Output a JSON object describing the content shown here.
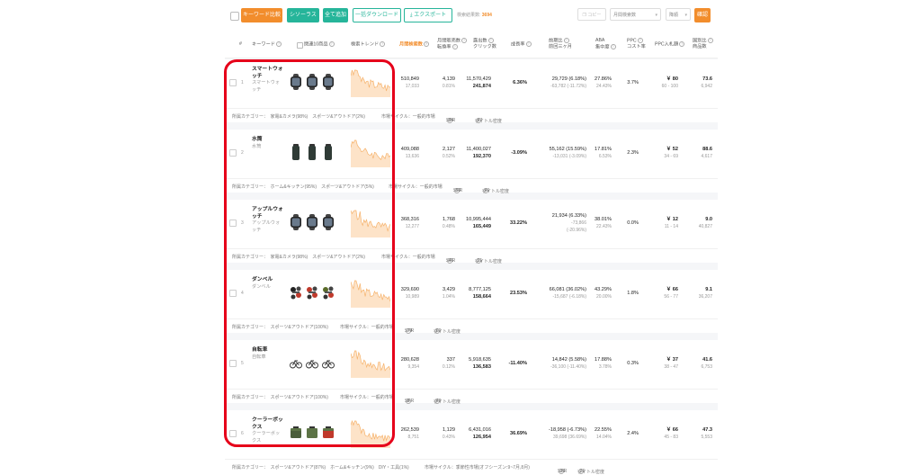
{
  "colors": {
    "accent": "#f28d2c",
    "green": "#26b59a",
    "annotation": "#e6001a"
  },
  "toolbar": {
    "compare_keywords": "キーワード比較",
    "thesaurus": "シソーラス",
    "add_all": "全て追加",
    "bulk_download": "一括ダウンロード",
    "export": "エクスポート",
    "search_results_label": "検索結果数:",
    "search_results_count": "3694",
    "copy": "コピー",
    "sort_select": "月間検索数",
    "order_select": "降順",
    "confirm": "確認"
  },
  "header": {
    "index": "#",
    "keyword": "キーワード",
    "related_products": "関連10商品",
    "search_trend": "検索トレンド",
    "monthly_search": "月間検索数",
    "monthly_sales_1": "月間販売数",
    "monthly_sales_2": "転換率",
    "display_1": "露出数",
    "display_2": "クリック数",
    "growth": "成長率",
    "prev_month_1": "前期比",
    "prev_month_2": "前回三ヶ月",
    "aba_1": "ABA",
    "aba_2": "集中度",
    "ppc_1": "PPC",
    "ppc_2": "コスト率",
    "ppc_bid": "PPC入札額",
    "products_1": "国別比",
    "products_2": "商品数"
  },
  "rows": [
    {
      "index": "1",
      "keyword_lines": [
        "スマートウォ",
        "ッチ"
      ],
      "translation_lines": [
        "スマートウォ",
        "ッチ"
      ],
      "thumb": "watch",
      "search_volume": "510,849",
      "search_sub": "17,033",
      "sales": "4,139",
      "sales_rate": "0.81%",
      "impressions": "11,570,429",
      "clicks": "241,874",
      "growth": "6.36%",
      "prev_main": "29,729 (6.18%)",
      "prev_sub1": "-63,782 (-11.72%)",
      "prev_sub2": "",
      "aba": "27.86%",
      "aba_sub": "24.43%",
      "ppc": "3.7%",
      "bid": "￥ 80",
      "bid_range": "60 - 100",
      "ratio": "73.6",
      "ratio_sub": "6,942",
      "foot": {
        "category": "所属カテゴリー：　家電&カメラ(98%)　スポーツ&アウトドア(2%)",
        "cycle": "市場サイクル：一般的市場",
        "spr": "SPR",
        "spr_val": ": 94",
        "title": "タイトル密度",
        "title_val": ": 47"
      }
    },
    {
      "index": "2",
      "keyword_lines": [
        "水筒"
      ],
      "translation_lines": [
        "水筒"
      ],
      "thumb": "bottle",
      "search_volume": "409,088",
      "search_sub": "13,636",
      "sales": "2,127",
      "sales_rate": "0.52%",
      "impressions": "11,400,027",
      "clicks": "192,370",
      "growth": "-3.09%",
      "prev_main": "55,162 (15.59%)",
      "prev_sub1": "-13,031 (-3.09%)",
      "prev_sub2": "",
      "aba": "17.81%",
      "aba_sub": "6.53%",
      "ppc": "2.3%",
      "bid": "￥ 52",
      "bid_range": "34 - 69",
      "ratio": "88.6",
      "ratio_sub": "4,617",
      "foot": {
        "category": "所属カテゴリー：　ホーム&キッチン(95%)　スポーツ&アウトドア(5%)",
        "cycle": "市場サイクル：一般的市場",
        "spr": "SPR",
        "spr_val": ": 50",
        "title": "タイトル密度",
        "title_val": ": 46"
      }
    },
    {
      "index": "3",
      "keyword_lines": [
        "アップルウォ",
        "ッチ"
      ],
      "translation_lines": [
        "アップルウォ",
        "ッチ"
      ],
      "thumb": "watch",
      "search_volume": "368,316",
      "search_sub": "12,277",
      "sales": "1,768",
      "sales_rate": "0.48%",
      "impressions": "10,995,444",
      "clicks": "165,449",
      "growth": "33.22%",
      "prev_main": "21,934 (6.33%)",
      "prev_sub1": "-73,866",
      "prev_sub2": "(-20.96%)",
      "aba": "38.01%",
      "aba_sub": "22.43%",
      "ppc": "0.0%",
      "bid": "￥ 12",
      "bid_range": "11 - 14",
      "ratio": "9.0",
      "ratio_sub": "40,827",
      "foot": {
        "category": "所属カテゴリー：　家電&カメラ(98%)　スポーツ&アウトドア(2%)",
        "cycle": "市場サイクル：一般的市場",
        "spr": "SPR",
        "spr_val": ": 41",
        "title": "タイトル密度",
        "title_val": ": 31"
      }
    },
    {
      "index": "4",
      "keyword_lines": [
        "ダンベル"
      ],
      "translation_lines": [
        "ダンベル"
      ],
      "thumb": "dumbbell",
      "search_volume": "329,690",
      "search_sub": "10,989",
      "sales": "3,429",
      "sales_rate": "1.04%",
      "impressions": "8,777,125",
      "clicks": "158,664",
      "growth": "23.53%",
      "prev_main": "66,081 (36.02%)",
      "prev_sub1": "-15,687 (-6.18%)",
      "prev_sub2": "",
      "aba": "43.29%",
      "aba_sub": "20.00%",
      "ppc": "1.8%",
      "bid": "￥ 66",
      "bid_range": "56 - 77",
      "ratio": "9.1",
      "ratio_sub": "36,207",
      "foot": {
        "category": "所属カテゴリー：　スポーツ&アウトドア(100%)",
        "cycle": "市場サイクル：一般的市場",
        "spr": "SPR",
        "spr_val": ": 79",
        "title": "タイトル密度",
        "title_val": ": 60"
      }
    },
    {
      "index": "5",
      "keyword_lines": [
        "自転車"
      ],
      "translation_lines": [
        "自転車"
      ],
      "thumb": "bike",
      "search_volume": "280,628",
      "search_sub": "9,354",
      "sales": "337",
      "sales_rate": "0.12%",
      "impressions": "5,918,635",
      "clicks": "136,583",
      "growth": "-11.40%",
      "prev_main": "14,842 (5.58%)",
      "prev_sub1": "-36,100 (-11.40%)",
      "prev_sub2": "",
      "aba": "17.88%",
      "aba_sub": "3.78%",
      "ppc": "0.3%",
      "bid": "￥ 37",
      "bid_range": "38 - 47",
      "ratio": "41.6",
      "ratio_sub": "6,753",
      "foot": {
        "category": "所属カテゴリー：　スポーツ&アウトドア(100%)",
        "cycle": "市場サイクル：一般的市場",
        "spr": "SPR",
        "spr_val": ": 8",
        "title": "タイトル密度",
        "title_val": ": 48"
      }
    },
    {
      "index": "6",
      "keyword_lines": [
        "クーラーボッ",
        "クス"
      ],
      "translation_lines": [
        "クーラーボッ",
        "クス"
      ],
      "thumb": "cooler",
      "search_volume": "262,539",
      "search_sub": "8,751",
      "sales": "1,129",
      "sales_rate": "0.43%",
      "impressions": "6,431,016",
      "clicks": "126,954",
      "growth": "36.69%",
      "prev_main": "-18,958 (-6.73%)",
      "prev_sub1": "39,698 (36.69%)",
      "prev_sub2": "",
      "aba": "22.55%",
      "aba_sub": "14.04%",
      "ppc": "2.4%",
      "bid": "￥ 66",
      "bid_range": "45 - 83",
      "ratio": "47.3",
      "ratio_sub": "5,553",
      "foot": {
        "category": "所属カテゴリー：　スポーツ&アウトドア(87%)　ホーム&キッチン(9%)　DIY・工具(1%)",
        "cycle": "市場サイクル：季節性市場(オフシーズン:9~7月,8月)",
        "spr": "SPR",
        "spr_val": ": 36",
        "title": "タイトル密度",
        "title_val": ": 36"
      }
    }
  ]
}
